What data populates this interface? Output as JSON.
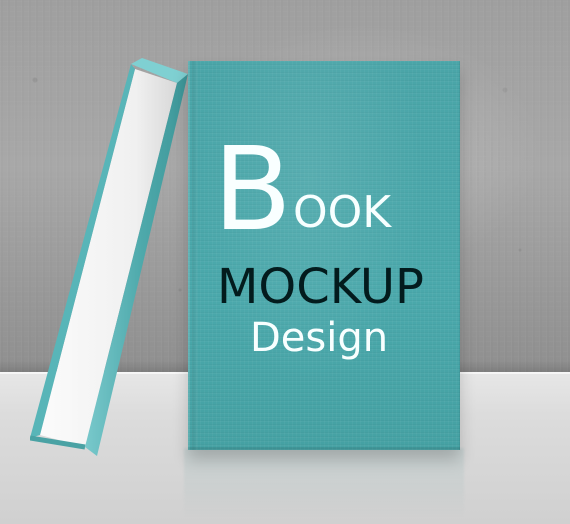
{
  "cover": {
    "big_letter": "B",
    "title_rest": "OOK",
    "subtitle": "MOCKUP",
    "tagline": "Design"
  },
  "colors": {
    "book_teal": "#4aa8ab",
    "cover_text_white": "#f8ffff",
    "cover_text_dark": "#031b1d",
    "wall_gray": "#a5a5a5",
    "table_gray": "#dcdcdc",
    "page_white": "#f4f4f4"
  }
}
